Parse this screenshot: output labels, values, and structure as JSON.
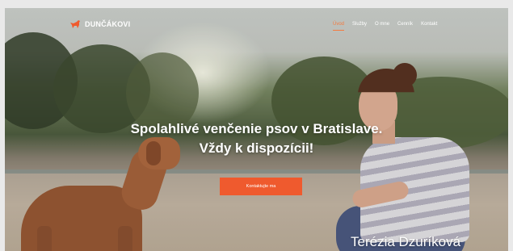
{
  "brand": {
    "name": "DUNČÁKOVI",
    "icon": "dog-icon",
    "accent": "#ef5a2e"
  },
  "nav": {
    "items": [
      {
        "label": "Úvod",
        "active": true
      },
      {
        "label": "Služby",
        "active": false
      },
      {
        "label": "O mne",
        "active": false
      },
      {
        "label": "Cenník",
        "active": false
      },
      {
        "label": "Kontakt",
        "active": false
      }
    ]
  },
  "hero": {
    "headline_line1": "Spolahlivé venčenie psov v Bratislave.",
    "headline_line2": "Vždy k dispozícii!",
    "cta_label": "Kontaktujte ma",
    "caption": "Terézia Dzuríková"
  }
}
